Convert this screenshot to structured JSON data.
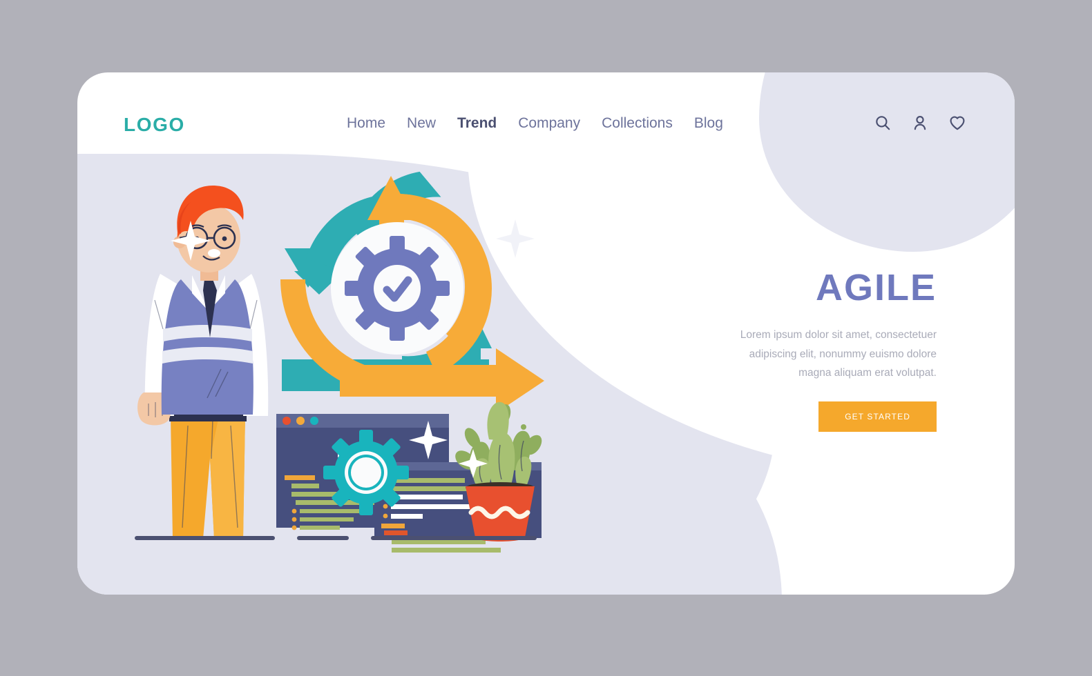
{
  "page": {
    "background_color": "#b1b1b9",
    "card_color": "#ffffff",
    "blob_color": "#e3e4ef"
  },
  "header": {
    "logo": "LOGO",
    "logo_color": "#2aada7",
    "nav": [
      {
        "label": "Home",
        "active": false
      },
      {
        "label": "New",
        "active": false
      },
      {
        "label": "Trend",
        "active": true
      },
      {
        "label": "Company",
        "active": false
      },
      {
        "label": "Collections",
        "active": false
      },
      {
        "label": "Blog",
        "active": false
      }
    ],
    "nav_color": "#6d739b",
    "nav_active_color": "#4b5071",
    "icons": [
      "search-icon",
      "user-icon",
      "heart-icon"
    ],
    "icon_color": "#4b5071"
  },
  "hero": {
    "title": "AGILE",
    "title_color": "#6f79bd",
    "body": "Lorem ipsum dolor sit amet, consectetuer adipiscing elit, nonummy euismo dolore magna aliquam erat volutpat.",
    "body_color": "#a9abb8",
    "cta_label": "GET STARTED",
    "cta_bg": "#f5a82c",
    "cta_text_color": "#ffffff"
  },
  "illustration": {
    "name": "agile-cycle-illustration",
    "colors": {
      "teal": "#2eadb3",
      "orange": "#f7ab38",
      "purple": "#6f79bd",
      "navy": "#4b5071",
      "window_dark": "#464f7e",
      "window_bar": "#5d6795",
      "gear_teal": "#19b4bd",
      "code_olive": "#a8bb6b",
      "code_white": "#ffffff",
      "code_orange": "#f0a63a",
      "code_red": "#e0562c",
      "dot_red": "#e8502f",
      "dot_orange": "#f3a93b",
      "dot_teal": "#19b4bd",
      "skin": "#f3c8a6",
      "hair": "#f4501e",
      "shirt": "#ffffff",
      "vest": "#7781c2",
      "tie": "#2c3150",
      "pants": "#f5a82c",
      "plant_green": "#8fae5e",
      "plant_light": "#a7c173",
      "pot": "#e8502f",
      "sparkle": "#ffffff"
    },
    "elements": [
      {
        "name": "developer-character",
        "desc": "Man with red hair, glasses, white shirt, purple sweater vest, dark tie, yellow pants"
      },
      {
        "name": "agile-cycle-arrows",
        "desc": "Teal and orange circular arrows forming an iterative cycle"
      },
      {
        "name": "gear-check-icon",
        "desc": "Purple gear with checkmark at center of cycle"
      },
      {
        "name": "code-window-left",
        "desc": "Dark code editor window with </> symbol"
      },
      {
        "name": "code-window-right",
        "desc": "Dark code editor window with code lines"
      },
      {
        "name": "teal-gear",
        "desc": "Teal gear overlapping the code windows"
      },
      {
        "name": "potted-cactus",
        "desc": "Green cactus in orange pot with white wave pattern"
      },
      {
        "name": "sparkle-stars",
        "desc": "Four-pointed decorative sparkles"
      }
    ],
    "code_symbol": "</>"
  }
}
